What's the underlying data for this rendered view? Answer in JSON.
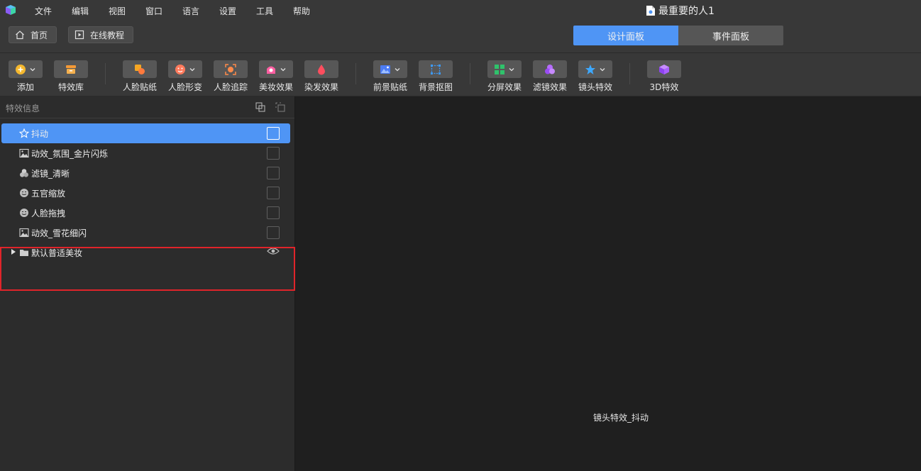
{
  "menubar": {
    "items": [
      "文件",
      "编辑",
      "视图",
      "窗口",
      "语言",
      "设置",
      "工具",
      "帮助"
    ],
    "document_title": "最重要的人1"
  },
  "subbar": {
    "home_label": "首页",
    "tutorial_label": "在线教程",
    "tabs": [
      {
        "label": "设计面板",
        "active": true
      },
      {
        "label": "事件面板",
        "active": false
      }
    ]
  },
  "toolbar": {
    "tools": [
      {
        "label": "添加",
        "icon": "add-icon",
        "dropdown": true
      },
      {
        "label": "特效库",
        "icon": "effects-library-icon",
        "dropdown": false
      },
      {
        "label": "人脸贴纸",
        "icon": "face-sticker-icon",
        "dropdown": false
      },
      {
        "label": "人脸形变",
        "icon": "face-deform-icon",
        "dropdown": true
      },
      {
        "label": "人脸追踪",
        "icon": "face-tracking-icon",
        "dropdown": false
      },
      {
        "label": "美妆效果",
        "icon": "makeup-icon",
        "dropdown": true
      },
      {
        "label": "染发效果",
        "icon": "hair-dye-icon",
        "dropdown": false
      },
      {
        "label": "前景贴纸",
        "icon": "foreground-sticker-icon",
        "dropdown": true
      },
      {
        "label": "背景抠图",
        "icon": "background-matting-icon",
        "dropdown": false
      },
      {
        "label": "分屏效果",
        "icon": "split-screen-icon",
        "dropdown": true
      },
      {
        "label": "滤镜效果",
        "icon": "filter-icon",
        "dropdown": false
      },
      {
        "label": "镜头特效",
        "icon": "lens-effect-icon",
        "dropdown": true
      },
      {
        "label": "3D特效",
        "icon": "3d-effect-icon",
        "dropdown": false
      }
    ]
  },
  "effects_panel": {
    "title": "特效信息",
    "items": [
      {
        "label": "抖动",
        "icon": "star-icon",
        "selected": true
      },
      {
        "label": "动效_氛围_金片闪烁",
        "icon": "image-icon",
        "selected": false
      },
      {
        "label": "滤镜_清晰",
        "icon": "filter-icon",
        "selected": false
      },
      {
        "label": "五官缩放",
        "icon": "face-icon",
        "selected": false
      },
      {
        "label": "人脸拖拽",
        "icon": "face-icon",
        "selected": false
      },
      {
        "label": "动效_雪花细闪",
        "icon": "image-icon",
        "selected": false
      },
      {
        "label": "默认普适美妆",
        "icon": "folder-icon",
        "selected": false
      }
    ]
  },
  "canvas": {
    "caption": "镜头特效_抖动"
  },
  "colors": {
    "accent": "#4f95f5",
    "highlight_border": "#e0242a"
  }
}
